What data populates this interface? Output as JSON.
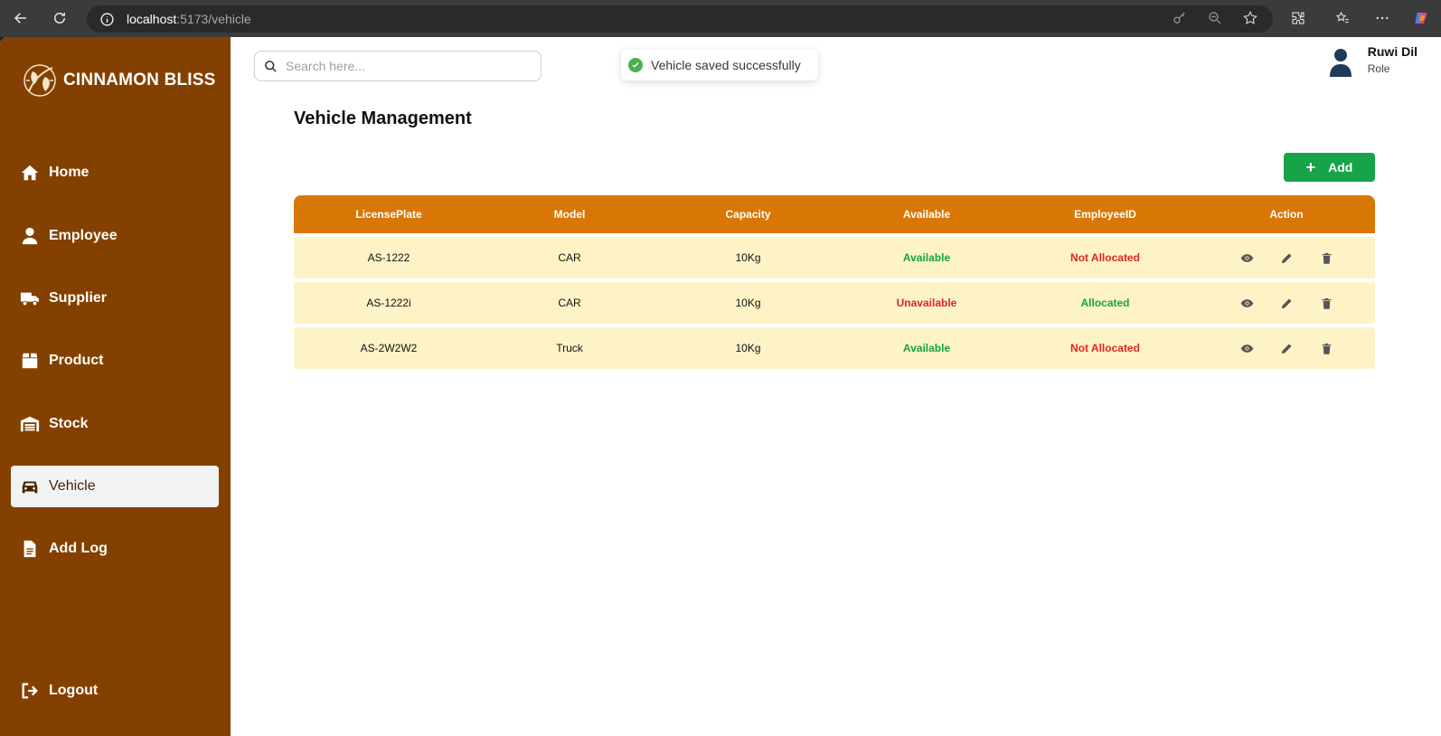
{
  "browser": {
    "url_host": "localhost",
    "url_path": ":5173/vehicle"
  },
  "sidebar": {
    "brand": "CINNAMON BLISS",
    "items": [
      {
        "label": "Home",
        "icon": "home-icon"
      },
      {
        "label": "Employee",
        "icon": "user-icon"
      },
      {
        "label": "Supplier",
        "icon": "truck-icon"
      },
      {
        "label": "Product",
        "icon": "box-icon"
      },
      {
        "label": "Stock",
        "icon": "warehouse-icon"
      },
      {
        "label": "Vehicle",
        "icon": "car-icon"
      },
      {
        "label": "Add Log",
        "icon": "document-icon"
      }
    ],
    "active": "Vehicle",
    "logout": "Logout"
  },
  "search": {
    "placeholder": "Search here..."
  },
  "toast": {
    "message": "Vehicle saved successfully"
  },
  "user": {
    "name": "Ruwi Dil",
    "role": "Role"
  },
  "page": {
    "title": "Vehicle Management",
    "add_label": "Add"
  },
  "table": {
    "headers": [
      "LicensePlate",
      "Model",
      "Capacity",
      "Available",
      "EmployeeID",
      "Action"
    ],
    "rows": [
      {
        "plate": "AS-1222",
        "model": "CAR",
        "capacity": "10Kg",
        "available": "Available",
        "employee": "Not Allocated"
      },
      {
        "plate": "AS-1222i",
        "model": "CAR",
        "capacity": "10Kg",
        "available": "Unavailable",
        "employee": "Allocated"
      },
      {
        "plate": "AS-2W2W2",
        "model": "Truck",
        "capacity": "10Kg",
        "available": "Available",
        "employee": "Not Allocated"
      }
    ]
  },
  "colors": {
    "sidebar": "#844000",
    "table_header": "#d97706",
    "row_bg": "#fef3c7",
    "add_button": "#17a34a",
    "positive": "#16a34a",
    "negative": "#dc2626"
  }
}
